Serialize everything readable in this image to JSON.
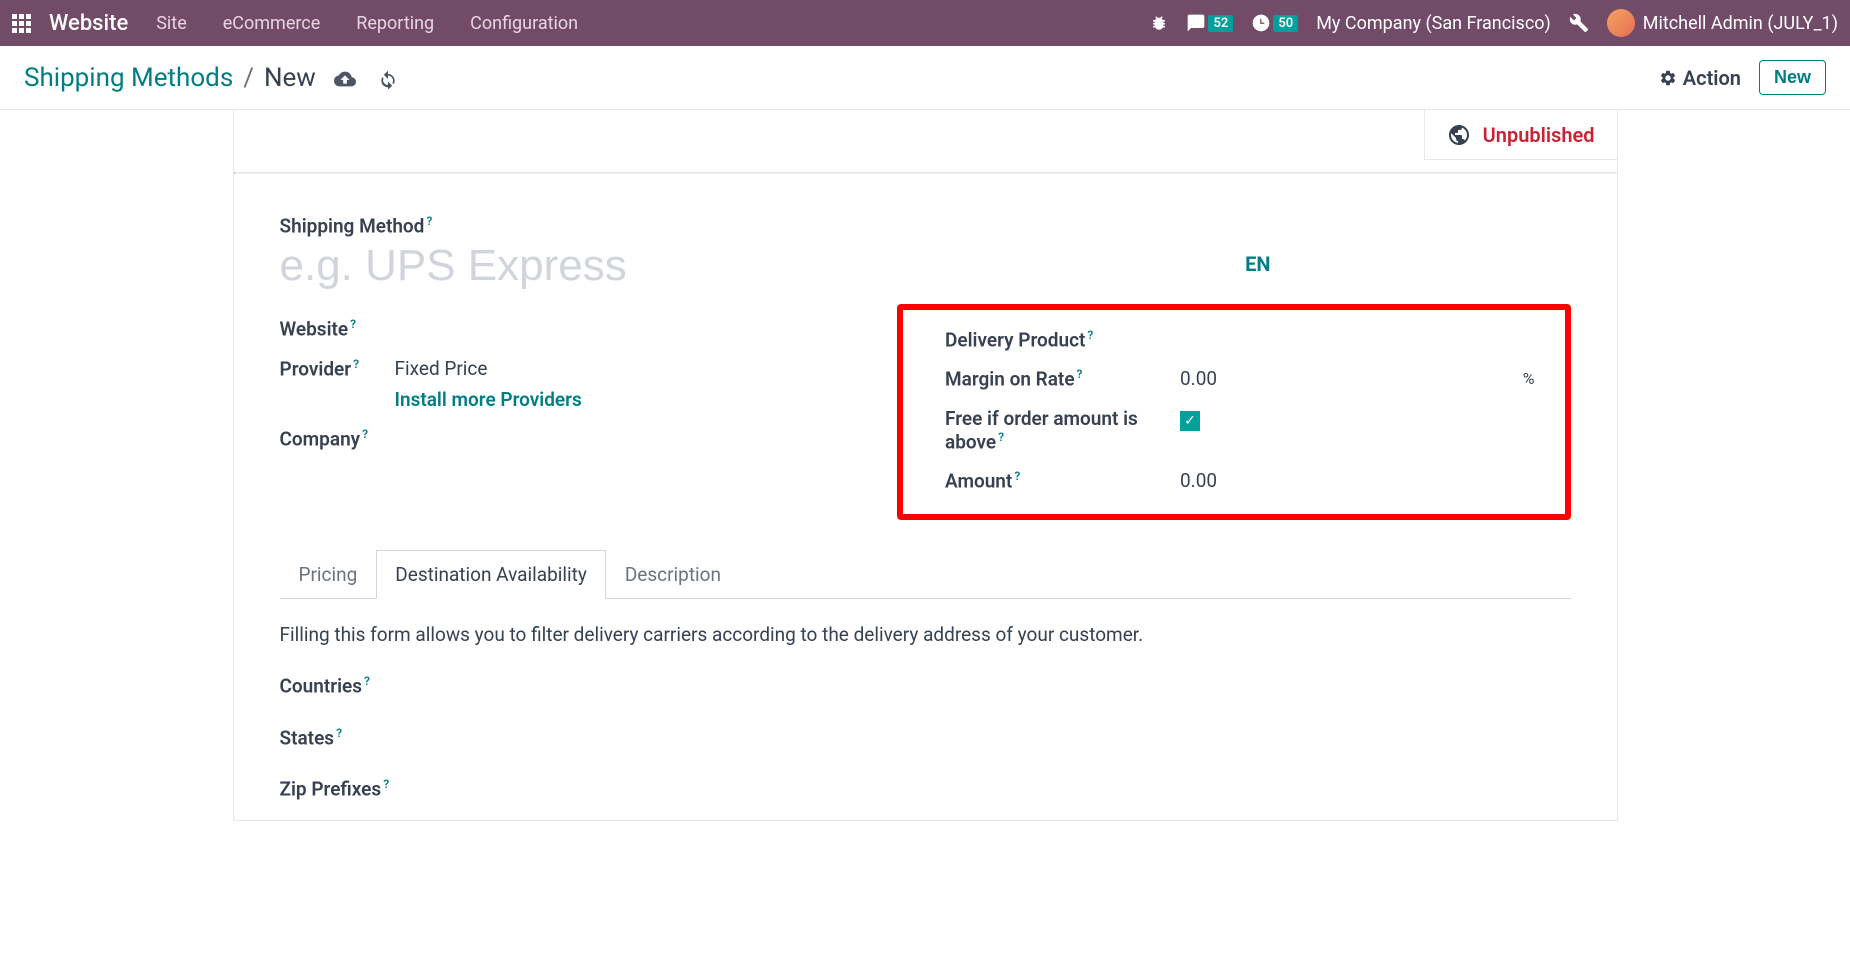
{
  "navbar": {
    "brand": "Website",
    "menu": [
      "Site",
      "eCommerce",
      "Reporting",
      "Configuration"
    ],
    "messages_badge": "52",
    "activities_badge": "50",
    "company": "My Company (San Francisco)",
    "user": "Mitchell Admin (JULY_1)"
  },
  "header": {
    "breadcrumb_root": "Shipping Methods",
    "breadcrumb_sep": "/",
    "breadcrumb_current": "New",
    "action_label": "Action",
    "new_label": "New"
  },
  "status": {
    "unpublished": "Unpublished"
  },
  "form": {
    "title_label": "Shipping Method",
    "title_placeholder": "e.g. UPS Express",
    "website_label": "Website",
    "provider_label": "Provider",
    "provider_value": "Fixed Price",
    "install_link": "Install more Providers",
    "company_label": "Company",
    "lang": "EN",
    "delivery_product_label": "Delivery Product",
    "margin_label": "Margin on Rate",
    "margin_value": "0.00",
    "percent": "%",
    "free_label": "Free if order amount is above",
    "free_checked": true,
    "amount_label": "Amount",
    "amount_value": "0.00",
    "help": "?"
  },
  "tabs": {
    "pricing": "Pricing",
    "destination": "Destination Availability",
    "description": "Description",
    "dest_help": "Filling this form allows you to filter delivery carriers according to the delivery address of your customer.",
    "countries": "Countries",
    "states": "States",
    "zip": "Zip Prefixes"
  }
}
